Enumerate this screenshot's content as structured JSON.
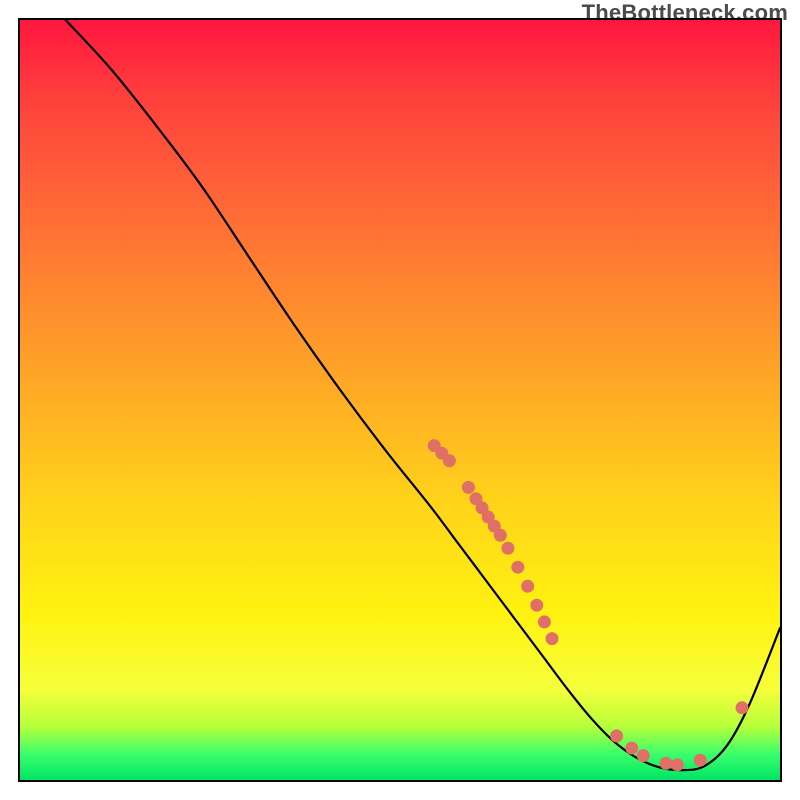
{
  "watermark": "TheBottleneck.com",
  "chart_data": {
    "type": "line",
    "title": "",
    "xlabel": "",
    "ylabel": "",
    "xlim": [
      0,
      100
    ],
    "ylim": [
      0,
      100
    ],
    "grid": false,
    "legend": false,
    "background_gradient": {
      "stops": [
        {
          "pos": 0.0,
          "color": "#ff163f"
        },
        {
          "pos": 0.1,
          "color": "#ff3f3d"
        },
        {
          "pos": 0.25,
          "color": "#ff6a36"
        },
        {
          "pos": 0.45,
          "color": "#ffa028"
        },
        {
          "pos": 0.63,
          "color": "#ffd21a"
        },
        {
          "pos": 0.78,
          "color": "#fff210"
        },
        {
          "pos": 0.88,
          "color": "#f6ff3a"
        },
        {
          "pos": 0.93,
          "color": "#b6ff3a"
        },
        {
          "pos": 0.965,
          "color": "#3dff6a"
        },
        {
          "pos": 1.0,
          "color": "#00e566"
        }
      ]
    },
    "series": [
      {
        "name": "bottleneck-curve",
        "color": "#000000",
        "stroke_width": 2.2,
        "x": [
          6,
          12,
          18,
          24,
          30,
          36,
          42,
          48,
          54,
          57,
          60,
          63,
          66,
          69,
          72,
          75,
          78,
          81,
          84,
          87,
          90,
          93,
          96,
          100
        ],
        "y": [
          100,
          93.5,
          86,
          78,
          69,
          60,
          51.5,
          43.5,
          36,
          32,
          28,
          24,
          20,
          16,
          12,
          8.3,
          5.2,
          3.0,
          1.7,
          1.3,
          1.8,
          4.5,
          10,
          20
        ]
      }
    ],
    "markers": {
      "name": "highlight-dots",
      "color": "#e07066",
      "radius": 6.5,
      "points": [
        {
          "x": 54.5,
          "y": 44.0
        },
        {
          "x": 55.5,
          "y": 43.0
        },
        {
          "x": 56.5,
          "y": 42.0
        },
        {
          "x": 59.0,
          "y": 38.5
        },
        {
          "x": 60.0,
          "y": 37.0
        },
        {
          "x": 60.8,
          "y": 35.8
        },
        {
          "x": 61.6,
          "y": 34.6
        },
        {
          "x": 62.4,
          "y": 33.4
        },
        {
          "x": 63.2,
          "y": 32.2
        },
        {
          "x": 64.2,
          "y": 30.5
        },
        {
          "x": 65.5,
          "y": 28.0
        },
        {
          "x": 66.8,
          "y": 25.5
        },
        {
          "x": 68.0,
          "y": 23.0
        },
        {
          "x": 69.0,
          "y": 20.8
        },
        {
          "x": 70.0,
          "y": 18.6
        },
        {
          "x": 78.5,
          "y": 5.8
        },
        {
          "x": 80.5,
          "y": 4.2
        },
        {
          "x": 82.0,
          "y": 3.2
        },
        {
          "x": 85.0,
          "y": 2.2
        },
        {
          "x": 86.5,
          "y": 2.0
        },
        {
          "x": 89.5,
          "y": 2.6
        },
        {
          "x": 95.0,
          "y": 9.5
        }
      ]
    }
  }
}
